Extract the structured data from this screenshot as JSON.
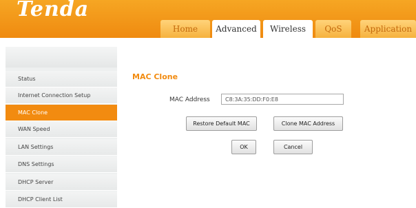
{
  "header": {
    "logo": "Tenda",
    "tabs": [
      {
        "label": "Home",
        "active": false
      },
      {
        "label": "Advanced",
        "active": true
      },
      {
        "label": "Wireless",
        "active": true
      },
      {
        "label": "QoS",
        "active": false
      },
      {
        "label": "Application",
        "active": false
      }
    ]
  },
  "sidebar": {
    "items": [
      {
        "label": "Status"
      },
      {
        "label": "Internet Connection Setup"
      },
      {
        "label": "MAC Clone",
        "active": true
      },
      {
        "label": "WAN Speed"
      },
      {
        "label": "LAN Settings"
      },
      {
        "label": "DNS Settings"
      },
      {
        "label": "DHCP Server"
      },
      {
        "label": "DHCP Client List"
      }
    ]
  },
  "main": {
    "title": "MAC Clone",
    "mac_label": "MAC Address",
    "mac_value": "C8:3A:35:DD:F0:E8",
    "restore_button": "Restore Default MAC",
    "clone_button": "Clone MAC Address",
    "ok_button": "OK",
    "cancel_button": "Cancel"
  },
  "colors": {
    "brand_orange": "#f28b10",
    "header_top": "#f6a623",
    "sidebar_bg": "#eef0f0"
  }
}
